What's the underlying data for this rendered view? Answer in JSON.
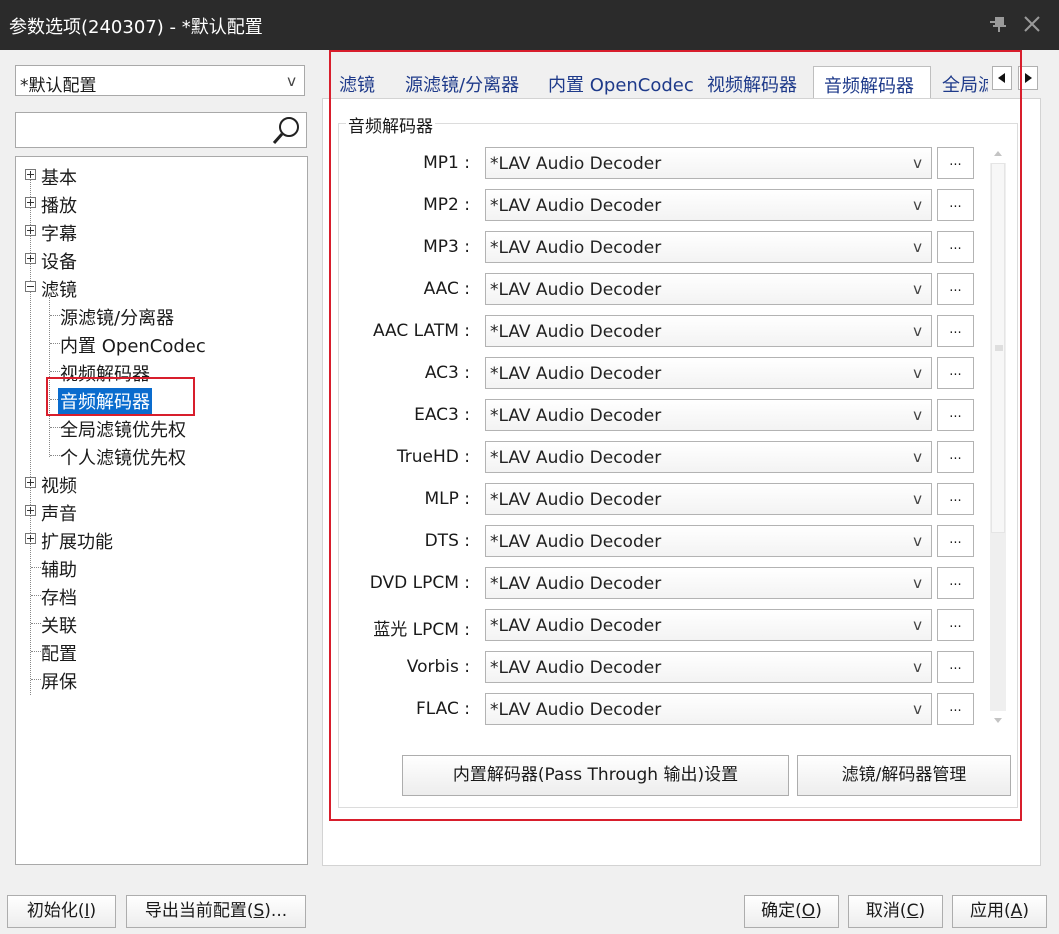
{
  "window": {
    "title": "参数选项(240307) - *默认配置",
    "pin_icon": "pin-icon",
    "close_icon": "close-icon"
  },
  "left": {
    "profile": {
      "value": "*默认配置",
      "arrow": "v"
    },
    "search": {
      "value": "",
      "placeholder": "",
      "icon": "magnifier-icon"
    },
    "tree": {
      "top": [
        {
          "label": "基本",
          "expandable": true
        },
        {
          "label": "播放",
          "expandable": true
        },
        {
          "label": "字幕",
          "expandable": true
        },
        {
          "label": "设备",
          "expandable": true
        },
        {
          "label": "滤镜",
          "expanded": true
        }
      ],
      "filter_children": [
        {
          "label": "源滤镜/分离器"
        },
        {
          "label": "内置 OpenCodec"
        },
        {
          "label": "视频解码器"
        },
        {
          "label": "音频解码器",
          "selected": true
        },
        {
          "label": "全局滤镜优先权"
        },
        {
          "label": "个人滤镜优先权"
        }
      ],
      "bottom": [
        {
          "label": "视频",
          "expandable": true
        },
        {
          "label": "声音",
          "expandable": true
        },
        {
          "label": "扩展功能",
          "expandable": true
        },
        {
          "label": "辅助"
        },
        {
          "label": "存档"
        },
        {
          "label": "关联"
        },
        {
          "label": "配置"
        },
        {
          "label": "屏保"
        }
      ]
    }
  },
  "tabs": [
    {
      "label": "滤镜"
    },
    {
      "label": "源滤镜/分离器"
    },
    {
      "label": "内置 OpenCodec"
    },
    {
      "label": "视频解码器"
    },
    {
      "label": "音频解码器",
      "active": true
    },
    {
      "label": "全局滤"
    }
  ],
  "group_title": "音频解码器",
  "decoders": [
    {
      "label": "MP1 :",
      "value": "*LAV Audio Decoder",
      "btn": "..."
    },
    {
      "label": "MP2 :",
      "value": "*LAV Audio Decoder",
      "btn": "..."
    },
    {
      "label": "MP3 :",
      "value": "*LAV Audio Decoder",
      "btn": "..."
    },
    {
      "label": "AAC :",
      "value": "*LAV Audio Decoder",
      "btn": "..."
    },
    {
      "label": "AAC LATM :",
      "value": "*LAV Audio Decoder",
      "btn": "..."
    },
    {
      "label": "AC3 :",
      "value": "*LAV Audio Decoder",
      "btn": "..."
    },
    {
      "label": "EAC3 :",
      "value": "*LAV Audio Decoder",
      "btn": "..."
    },
    {
      "label": "TrueHD :",
      "value": "*LAV Audio Decoder",
      "btn": "..."
    },
    {
      "label": "MLP :",
      "value": "*LAV Audio Decoder",
      "btn": "..."
    },
    {
      "label": "DTS :",
      "value": "*LAV Audio Decoder",
      "btn": "..."
    },
    {
      "label": "DVD LPCM :",
      "value": "*LAV Audio Decoder",
      "btn": "..."
    },
    {
      "label": "蓝光 LPCM :",
      "value": "*LAV Audio Decoder",
      "btn": "..."
    },
    {
      "label": "Vorbis :",
      "value": "*LAV Audio Decoder",
      "btn": "..."
    },
    {
      "label": "FLAC :",
      "value": "*LAV Audio Decoder",
      "btn": "..."
    }
  ],
  "select_arrow": "v",
  "actions": {
    "passthrough": "内置解码器(Pass Through 输出)设置",
    "manage": "滤镜/解码器管理"
  },
  "footer": {
    "init": {
      "text": "初始化(",
      "key": "I",
      "end": ")"
    },
    "export": {
      "text": "导出当前配置(",
      "key": "S",
      "end": ")..."
    },
    "ok": {
      "text": "确定(",
      "key": "O",
      "end": ")"
    },
    "cancel": {
      "text": "取消(",
      "key": "C",
      "end": ")"
    },
    "apply": {
      "text": "应用(",
      "key": "A",
      "end": ")"
    }
  },
  "colors": {
    "titlebar": "#2b2b2b",
    "selection": "#0a6cce",
    "highlight": "#d81e2c",
    "tab_text": "#1e3a8a"
  }
}
